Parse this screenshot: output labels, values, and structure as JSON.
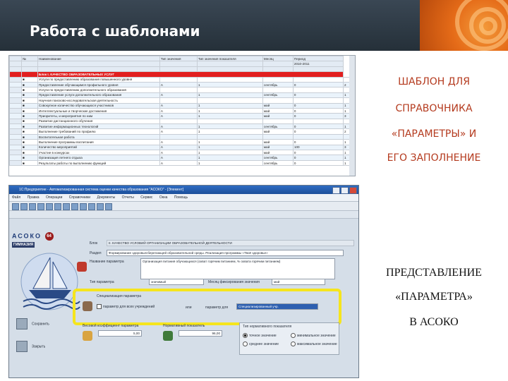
{
  "slide": {
    "title": "Работа с шаблонами",
    "caption_top": [
      "ШАБЛОН ДЛЯ",
      "СПРАВОЧНИКА",
      "«ПАРАМЕТРЫ» И",
      "ЕГО ЗАПОЛНЕНИЕ"
    ],
    "caption_bottom": [
      "ПРЕДСТАВЛЕНИЕ",
      "«ПАРАМЕТРА»",
      "В АСОКО"
    ],
    "accent_color": "#e56b18",
    "caption_color": "#b43a1e",
    "highlight_color": "#f5e51d"
  },
  "spreadsheet": {
    "headers": [
      "№",
      "Наименование",
      "Тип значения",
      "Тип значения показателя",
      "Месяц",
      "Период"
    ],
    "section_row": "Блок I. КАЧЕСТВО ОБРАЗОВАТЕЛЬНЫХ УСЛУГ",
    "period_value": "2010-2011",
    "rows": [
      [
        "Услуги по предоставлению образования повышенного уровня",
        "",
        "",
        "",
        "",
        ""
      ],
      [
        "Предоставление обучающимся профильного уровня",
        "А",
        "1",
        "сентябрь",
        "0",
        "2"
      ],
      [
        "Услуги по предоставлению дополнительного образования",
        "",
        "",
        "",
        "",
        ""
      ],
      [
        "Предоставление услуги дополнительного образования",
        "А",
        "1",
        "сентябрь",
        "0",
        "1"
      ],
      [
        "Научная поисково-исследовательская деятельность",
        "",
        "",
        "",
        "",
        ""
      ],
      [
        "Совокупное количество обучающихся участников",
        "А",
        "1",
        "май",
        "0",
        "1"
      ],
      [
        "Интеллектуальные и творческие достижения",
        "А",
        "1",
        "май",
        "0",
        "1"
      ],
      [
        "Приоритеты, и мероприятия по ним",
        "А",
        "1",
        "май",
        "0",
        "3"
      ],
      [
        "Развитие дистанционного обучения",
        "",
        "",
        "",
        "",
        ""
      ],
      [
        "Развитие информационных технологий",
        "А",
        "1",
        "сентябрь",
        "0",
        "1"
      ],
      [
        "Выполнение требований по профилю",
        "А",
        "1",
        "май",
        "0",
        "2"
      ],
      [
        "Воспитательная работа",
        "",
        "",
        "",
        "",
        ""
      ],
      [
        "Выполнение программы воспитания",
        "А",
        "1",
        "май",
        "0",
        "1"
      ],
      [
        "Количество мероприятий",
        "А",
        "1",
        "май",
        "100",
        "3"
      ],
      [
        "Участие в конкурсах",
        "А",
        "1",
        "май",
        "0",
        "1"
      ],
      [
        "Организация летнего отдыха",
        "А",
        "1",
        "сентябрь",
        "0",
        "1"
      ],
      [
        "Результаты работы по выполнению функций",
        "А",
        "1",
        "сентябрь",
        "0",
        "1"
      ]
    ]
  },
  "app": {
    "window_title": "1С:Предприятие - Автоматизированная система оценки качества образования \"АСОКО\" - [Элемент]",
    "menu": [
      "Файл",
      "Правка",
      "Операции",
      "Справочники",
      "Документы",
      "Отчеты",
      "Сервис",
      "Окна",
      "Помощь"
    ],
    "logo_text": "АСОКО",
    "logo_badge": "64",
    "logo_sub": "ГИМНАЗИЯ",
    "block_label": "Блок",
    "block_value": "II. КАЧЕСТВО УСЛОВИЙ ОРГАНИЗАЦИИ ОБРАЗОВАТЕЛЬНОЙ ДЕЯТЕЛЬНОСТИ",
    "section_label": "Раздел",
    "section_value": "Формирование здоровьесберегающей образовательной среды. Реализация программы «Твоё здоровье»",
    "param_name_label": "Название параметра",
    "param_name_value": "Организация питания обучающихся (охват горячим питанием, % охвата горячим питанием)",
    "param_type_label": "Тип параметра",
    "param_type_value": "значимый",
    "fix_month_label": "Месяц фиксирования значения",
    "fix_month_value": "май",
    "special_label": "Специализация параметра",
    "special_opt1": "параметр для всех учреждений",
    "special_or": "или",
    "special_opt2": "параметр для",
    "special_value": "Специализированный учр.",
    "weight_label": "Весовой коэффициент параметра",
    "weight_value": "5,00",
    "norm_label": "Нормативный показатель",
    "norm_value": "96,00",
    "norm_type_label": "Тип нормативного показателя",
    "radios": [
      "точное значение",
      "минимальное значение",
      "среднее значение",
      "максимальное значение"
    ],
    "save_label": "Сохранить",
    "close_label": "Закрыть"
  }
}
